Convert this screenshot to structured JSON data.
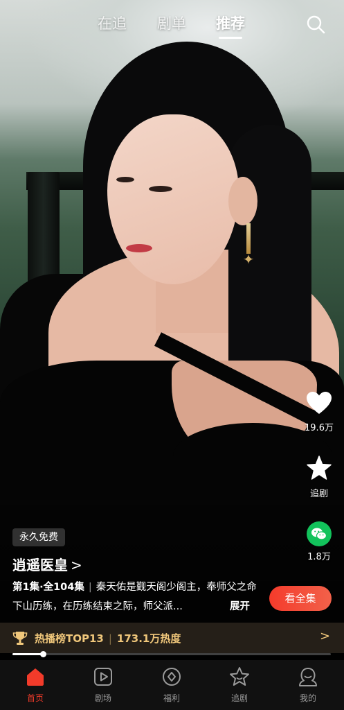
{
  "top_tabs": [
    {
      "label": "在追",
      "active": false
    },
    {
      "label": "剧单",
      "active": false
    },
    {
      "label": "推荐",
      "active": true
    }
  ],
  "icons": {
    "search": "search-icon",
    "like": "heart-icon",
    "follow": "star-icon",
    "share": "wechat-icon",
    "trophy": "trophy-icon"
  },
  "actions": {
    "like_count": "19.6万",
    "follow_label": "追剧",
    "share_count": "1.8万"
  },
  "drama": {
    "badge": "永久免费",
    "title": "逍遥医皇",
    "title_chevron": ">",
    "episode_info": "第1集·全104集",
    "synopsis": "秦天佑是觐天阁少阁主，奉师父之命下山历练，在历练结束之际，师父派...",
    "expand_label": "展开",
    "watch_all_label": "看全集"
  },
  "hot_list": {
    "rank_label": "热播榜TOP13",
    "heat_label": "173.1万热度",
    "chevron": ">"
  },
  "playback": {
    "progress_fraction": 0.095
  },
  "bottom_nav": [
    {
      "label": "首页",
      "icon": "home-icon",
      "active": true
    },
    {
      "label": "剧场",
      "icon": "play-square-icon",
      "active": false
    },
    {
      "label": "福利",
      "icon": "gift-diamond-icon",
      "active": false
    },
    {
      "label": "追剧",
      "icon": "star-badge-icon",
      "active": false
    },
    {
      "label": "我的",
      "icon": "profile-icon",
      "active": false
    }
  ],
  "colors": {
    "accent": "#f23b2a",
    "hot_gold": "#f0c77b",
    "wechat_green": "#12c25b"
  }
}
